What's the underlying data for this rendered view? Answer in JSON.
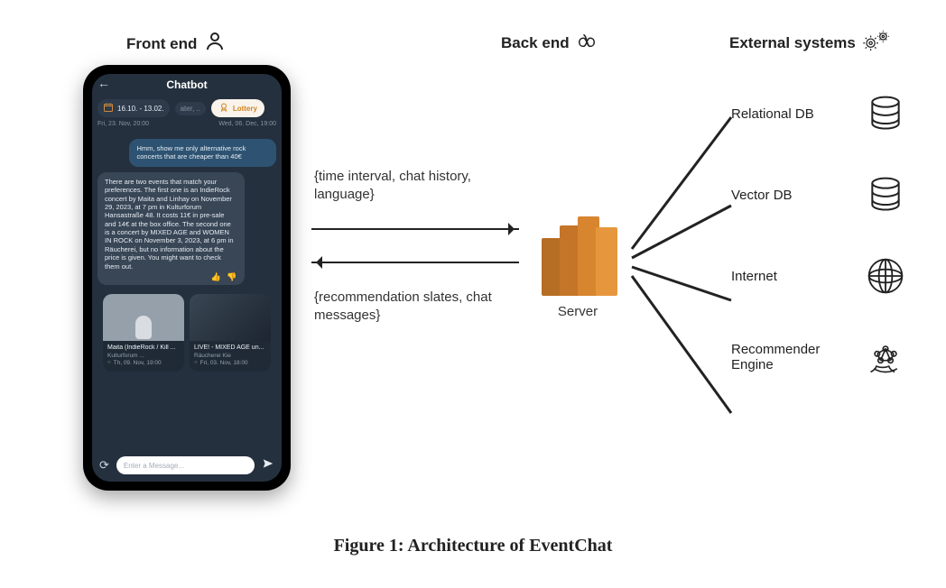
{
  "headers": {
    "frontend": "Front end",
    "backend": "Back end",
    "external": "External systems"
  },
  "phone": {
    "title": "Chatbot",
    "date_chip": "16.10. - 13.02.",
    "fader_chip": "ater, ..",
    "lottery_chip": "Lottery",
    "meta_left": "Fri, 23. Nov, 20:00",
    "meta_right": "Wed, 06. Dec, 19:00",
    "user_message": "Hmm, show me only alternative rock concerts that are cheaper than 40€",
    "bot_message": "There are two events that match your preferences. The first one is an IndieRock concert by Maita and Linhay on November 29, 2023, at 7 pm in Kulturforum Hansastraße 48. It costs 11€ in pre-sale and 14€ at the box office. The second one is a concert by MIXED AGE and WOMEN IN ROCK on November 3, 2023, at 6 pm in Räucherei, but no information about the price is given. You might want to check them out.",
    "reactions": "👍 👎",
    "cards": [
      {
        "title": "Maita (IndieRock / Kill ...",
        "venue": "Kulturforum ...",
        "time": "Th, 09. Nov, 19:00"
      },
      {
        "title": "LIVE! - MIXED AGE un...",
        "venue": "Räucherei    Kie",
        "time": "Fri, 03. Nov, 18:00"
      }
    ],
    "input_placeholder": "Enter a Message..."
  },
  "annotations": {
    "request": "{time interval, chat history, language}",
    "response": "{recommendation slates, chat messages}"
  },
  "server_label": "Server",
  "external_systems": [
    "Relational DB",
    "Vector DB",
    "Internet",
    "Recommender Engine"
  ],
  "caption": "Figure 1: Architecture of EventChat"
}
